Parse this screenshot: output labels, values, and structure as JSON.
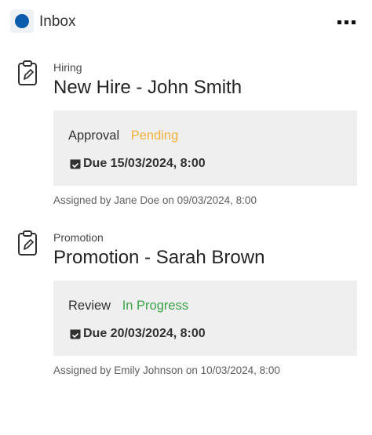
{
  "header": {
    "title": "Inbox",
    "logo_icon": "app-logo-icon",
    "more_icon": "more-horizontal-icon"
  },
  "tasks": [
    {
      "category": "Hiring",
      "title": "New Hire - John Smith",
      "status_label": "Approval",
      "status_value": "Pending",
      "status_color": "#f2b33d",
      "due": "Due 15/03/2024, 8:00",
      "assigned": "Assigned by Jane Doe on 09/03/2024, 8:00",
      "icon": "clipboard-edit-icon"
    },
    {
      "category": "Promotion",
      "title": "Promotion - Sarah Brown",
      "status_label": "Review",
      "status_value": "In Progress",
      "status_color": "#3aa346",
      "due": "Due 20/03/2024, 8:00",
      "assigned": "Assigned by Emily Johnson on 10/03/2024, 8:00",
      "icon": "clipboard-edit-icon"
    }
  ],
  "colors": {
    "accent": "#0b5cad",
    "card_background": "#efefef"
  }
}
